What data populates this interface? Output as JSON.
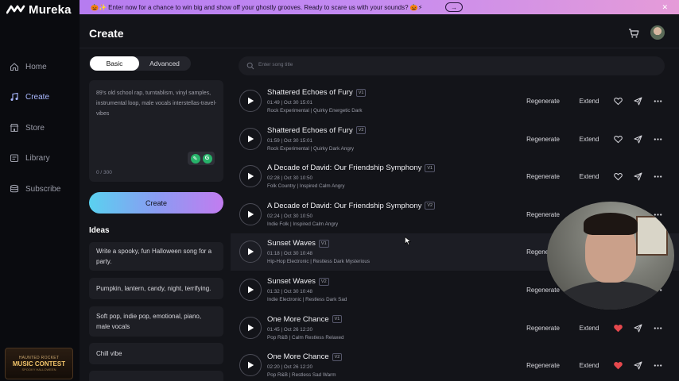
{
  "app": {
    "name": "Mureka",
    "nav": [
      {
        "label": "Home",
        "icon": "home-icon",
        "active": false
      },
      {
        "label": "Create",
        "icon": "music-note-icon",
        "active": true
      },
      {
        "label": "Store",
        "icon": "store-icon",
        "active": false
      },
      {
        "label": "Library",
        "icon": "library-icon",
        "active": false
      },
      {
        "label": "Subscribe",
        "icon": "subscribe-icon",
        "active": false
      }
    ],
    "contest_badge": {
      "line1": "HAUNTED ROCKET",
      "line2": "MUSIC CONTEST",
      "line3": "SPOOKY HALLOWEEN"
    }
  },
  "banner": {
    "text": "🎃✨ Enter now for a chance to win big and show off your ghostly grooves. Ready to scare us with your sounds? 🎃⚡",
    "arrow": "→",
    "close": "✕"
  },
  "header": {
    "title": "Create"
  },
  "create_panel": {
    "tabs": [
      "Basic",
      "Advanced"
    ],
    "active_tab": "Basic",
    "prompt": "89's old school rap, turntablism, vinyl samples, instrumental loop, male vocals interstellas-travel-vibes",
    "counter": "0 / 300",
    "create_label": "Create",
    "ideas_title": "Ideas",
    "ideas": [
      "Write a spooky, fun Halloween song for a party.",
      "Pumpkin, lantern, candy, night, terrifying.",
      "Soft pop, indie pop, emotional, piano, male vocals",
      "Chill vibe"
    ]
  },
  "search": {
    "placeholder": "Enter song title"
  },
  "songs": [
    {
      "title": "Shattered Echoes of Fury",
      "version": "V1",
      "meta1": "01:49  |  Oct 30 15:01",
      "meta2": "Rock Experimental  |  Quirky Energetic Dark",
      "regenerate": "Regenerate",
      "extend": "Extend",
      "liked": false
    },
    {
      "title": "Shattered Echoes of Fury",
      "version": "V2",
      "meta1": "01:59  |  Oct 30 15:01",
      "meta2": "Rock Experimental  |  Quirky Dark Angry",
      "regenerate": "Regenerate",
      "extend": "Extend",
      "liked": false
    },
    {
      "title": "A Decade of David: Our Friendship Symphony",
      "version": "V1",
      "meta1": "02:28  |  Oct 30 10:50",
      "meta2": "Folk Country  |  Inspired Calm Angry",
      "regenerate": "Regenerate",
      "extend": "Extend",
      "liked": false
    },
    {
      "title": "A Decade of David: Our Friendship Symphony",
      "version": "V2",
      "meta1": "02:24  |  Oct 30 10:50",
      "meta2": "Indie Folk  |  Inspired Calm Angry",
      "regenerate": "Regenerate",
      "extend": "Extend",
      "liked": false
    },
    {
      "title": "Sunset Waves",
      "version": "V1",
      "meta1": "01:18  |  Oct 30 10:48",
      "meta2": "Hip-Hop Electronic  |  Restless Dark Mysterious",
      "regenerate": "Regenerate",
      "extend": "Extend",
      "liked": false
    },
    {
      "title": "Sunset Waves",
      "version": "V2",
      "meta1": "01:32  |  Oct 30 10:48",
      "meta2": "Indie Electronic  |  Restless Dark Sad",
      "regenerate": "Regenerate",
      "extend": "Extend",
      "liked": false
    },
    {
      "title": "One More Chance",
      "version": "V1",
      "meta1": "01:45  |  Oct 26 12:20",
      "meta2": "Pop R&B  |  Calm Restless Relaxed",
      "regenerate": "Regenerate",
      "extend": "Extend",
      "liked": true
    },
    {
      "title": "One More Chance",
      "version": "V2",
      "meta1": "02:20  |  Oct 26 12:20",
      "meta2": "Pop R&B  |  Restless Sad Warm",
      "regenerate": "Regenerate",
      "extend": "Extend",
      "liked": true
    }
  ],
  "colors": {
    "accent": "#a9b8ff",
    "liked": "#e5484d",
    "banner_start": "#b67cf0",
    "banner_end": "#e59bd8"
  }
}
